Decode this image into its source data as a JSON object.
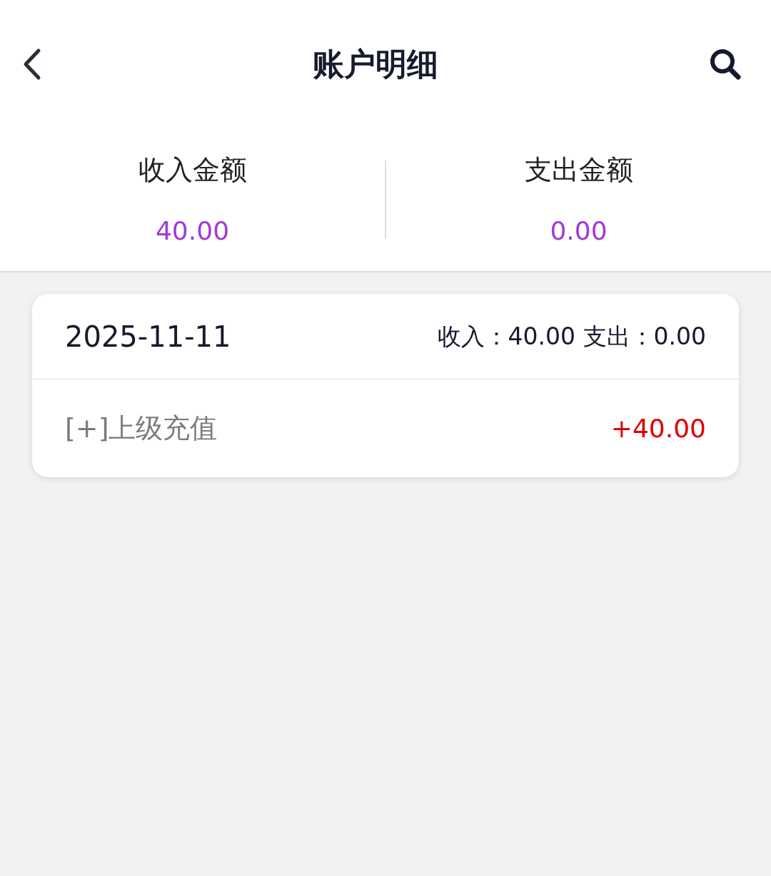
{
  "header": {
    "title": "账户明细"
  },
  "summary": [
    {
      "label": "收入金额",
      "value": "40.00"
    },
    {
      "label": "支出金额",
      "value": "0.00"
    }
  ],
  "days": [
    {
      "date": "2025-11-11",
      "totals": "收入：40.00 支出：0.00",
      "entries": [
        {
          "label": "[+]上级充值",
          "amount": "+40.00",
          "kind": "income"
        }
      ]
    }
  ]
}
